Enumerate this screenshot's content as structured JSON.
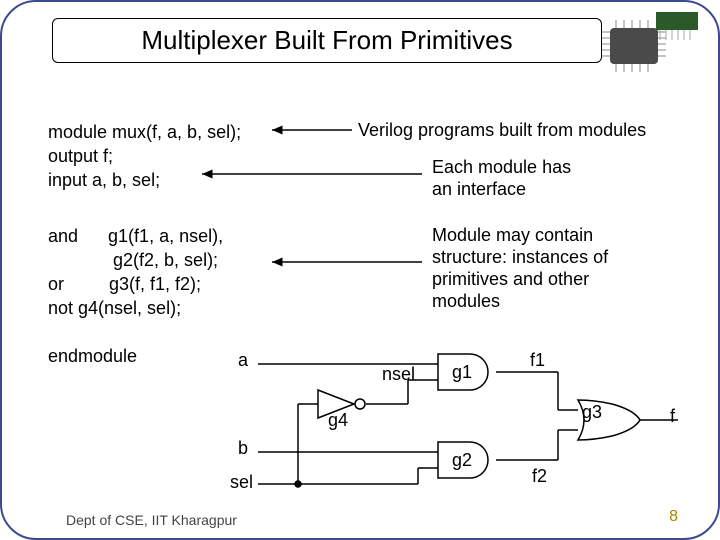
{
  "title": "Multiplexer Built From Primitives",
  "code_header": "module mux(f, a, b, sel);\noutput f;\ninput a, b, sel;",
  "code_body": "and      g1(f1, a, nsel),\n             g2(f2, b, sel);\nor         g3(f, f1, f2);\nnot g4(nsel, sel);\n\nendmodule",
  "note_top": "Verilog programs built from modules",
  "note_interface": "Each module has\nan interface",
  "note_structure": "Module may contain\nstructure: instances of\nprimitives and other\nmodules",
  "labels": {
    "a": "a",
    "b": "b",
    "sel": "sel",
    "nsel": "nsel",
    "g1": "g1",
    "g2": "g2",
    "g3": "g3",
    "g4": "g4",
    "f1": "f1",
    "f2": "f2",
    "f": "f"
  },
  "footer": "Dept of CSE, IIT Kharagpur",
  "page": "8"
}
